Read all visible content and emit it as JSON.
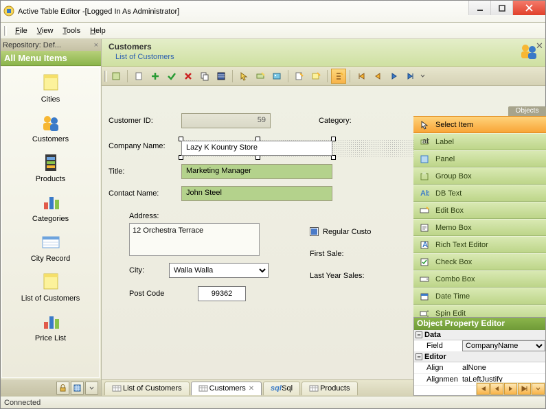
{
  "window": {
    "title": "Active Table Editor -[Logged In As Administrator]"
  },
  "menu": {
    "file": "File",
    "view": "View",
    "tools": "Tools",
    "help": "Help"
  },
  "repository": {
    "label": "Repository: Def..."
  },
  "sidebar": {
    "header": "All Menu Items",
    "items": [
      {
        "label": "Cities",
        "icon": "note-icon"
      },
      {
        "label": "Customers",
        "icon": "people-icon"
      },
      {
        "label": "Products",
        "icon": "film-icon"
      },
      {
        "label": "Categories",
        "icon": "barchart-icon"
      },
      {
        "label": "City Record",
        "icon": "record-icon"
      },
      {
        "label": "List of Customers",
        "icon": "note-icon"
      },
      {
        "label": "Price List",
        "icon": "barchart-icon"
      }
    ]
  },
  "page": {
    "title": "Customers",
    "subtitle": "List of Customers"
  },
  "form": {
    "customer_id_label": "Customer ID:",
    "customer_id": "59",
    "category_label": "Category:",
    "company_name_label": "Company Name:",
    "company_name": "Lazy K Kountry Store",
    "title_label": "Title:",
    "title": "Marketing Manager",
    "contact_name_label": "Contact Name:",
    "contact_name": "John Steel",
    "address_label": "Address:",
    "address": "12 Orchestra Terrace",
    "city_label": "City:",
    "city": "Walla Walla",
    "postcode_label": "Post Code",
    "postcode": "99362",
    "regular_label": "Regular Custo",
    "first_sale_label": "First Sale:",
    "last_year_label": "Last Year Sales:"
  },
  "objects": {
    "header": "Objects",
    "items": [
      {
        "label": "Select Item",
        "icon": "cursor-icon",
        "selected": true
      },
      {
        "label": "Label",
        "icon": "label-icon"
      },
      {
        "label": "Panel",
        "icon": "panel-icon"
      },
      {
        "label": "Group Box",
        "icon": "groupbox-icon"
      },
      {
        "label": "DB Text",
        "icon": "dbtext-icon"
      },
      {
        "label": "Edit Box",
        "icon": "editbox-icon"
      },
      {
        "label": "Memo Box",
        "icon": "memo-icon"
      },
      {
        "label": "Rich Text Editor",
        "icon": "rte-icon"
      },
      {
        "label": "Check Box",
        "icon": "checkbox-icon"
      },
      {
        "label": "Combo Box",
        "icon": "combo-icon"
      },
      {
        "label": "Date Time",
        "icon": "datetime-icon"
      },
      {
        "label": "Spin Edit",
        "icon": "spinedit-icon"
      }
    ]
  },
  "prop_editor": {
    "title": "Object Property Editor",
    "sections": {
      "data": "Data",
      "editor": "Editor"
    },
    "rows": {
      "field_key": "Field",
      "field_val": "CompanyName",
      "align_key": "Align",
      "align_val": "alNone",
      "alignment_key": "Alignment",
      "alignment_val": "taLeftJustify"
    }
  },
  "tabs": [
    {
      "label": "List of Customers",
      "icon": "grid-icon"
    },
    {
      "label": "Customers",
      "icon": "grid-icon",
      "active": true,
      "closable": true
    },
    {
      "label": "Sql",
      "icon": "sql-icon"
    },
    {
      "label": "Products",
      "icon": "grid-icon"
    }
  ],
  "status": {
    "text": "Connected"
  }
}
